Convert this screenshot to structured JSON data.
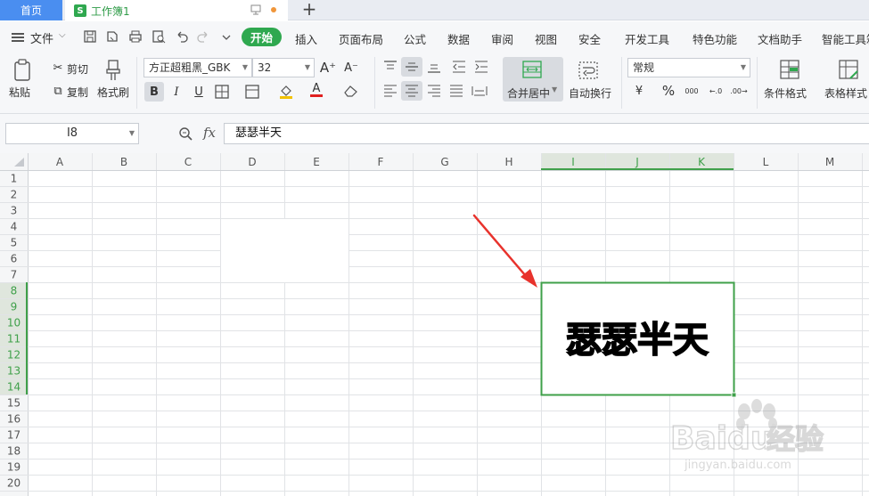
{
  "tabs": {
    "home_label": "首页",
    "doc_logo": "S",
    "doc_label": "工作簿1",
    "add_label": "+"
  },
  "menu": {
    "file_label": "文件",
    "start_label": "开始",
    "items": [
      "插入",
      "页面布局",
      "公式",
      "数据",
      "审阅",
      "视图",
      "安全",
      "开发工具",
      "特色功能",
      "文档助手",
      "智能工具箱"
    ]
  },
  "ribbon": {
    "paste_label": "粘贴",
    "cut_label": "剪切",
    "copy_label": "复制",
    "format_painter_label": "格式刷",
    "font_name": "方正超粗黑_GBK",
    "font_size": "32",
    "bold": "B",
    "italic": "I",
    "underline": "U",
    "font_color_glyph": "A",
    "merge_label": "合并居中",
    "wrap_label": "自动换行",
    "number_format": "常规",
    "percent": "%",
    "thousands": "000",
    "conditional_format_label": "条件格式",
    "table_style_label": "表格样式",
    "accent_color": "#2fa84f",
    "font_color_bar": "#e02020"
  },
  "formula": {
    "cell_ref": "I8",
    "fx": "fx",
    "content": "瑟瑟半天"
  },
  "sheet": {
    "columns": [
      "A",
      "B",
      "C",
      "D",
      "E",
      "F",
      "G",
      "H",
      "I",
      "J",
      "K",
      "L",
      "M"
    ],
    "rows": [
      "1",
      "2",
      "3",
      "4",
      "5",
      "6",
      "7",
      "8",
      "9",
      "10",
      "11",
      "12",
      "13",
      "14",
      "15",
      "16",
      "17",
      "18",
      "19",
      "20"
    ],
    "selected_columns": [
      "I",
      "J",
      "K"
    ],
    "selected_rows": [
      "8",
      "9",
      "10",
      "11",
      "12",
      "13",
      "14"
    ],
    "merged_cell_text": "瑟瑟半天",
    "selection_color": "#3fa04a"
  },
  "watermark": {
    "brand": "Baidu",
    "cn": "经验",
    "url": "jingyan.baidu.com"
  }
}
